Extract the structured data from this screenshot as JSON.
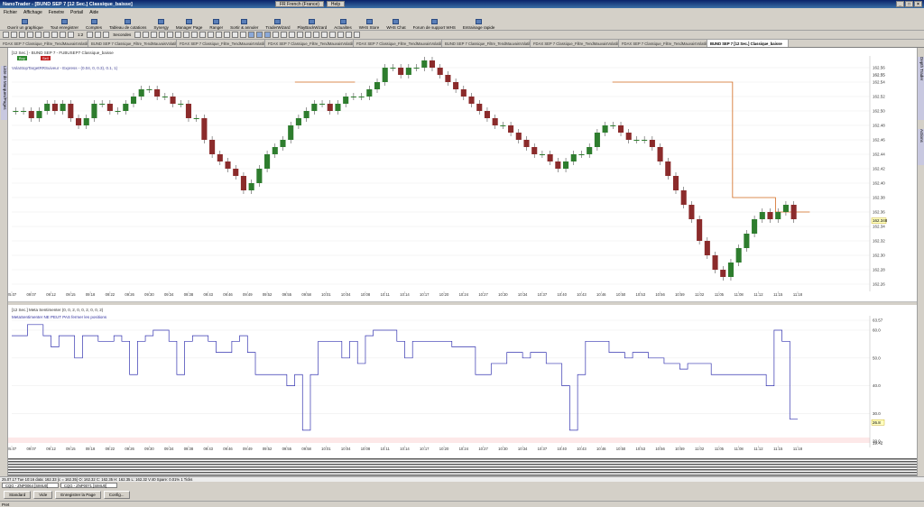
{
  "window": {
    "title": "NanoTrader - [BUND SEP 7 [12 Sec.] Classique_baisse]",
    "center_items": [
      "FR French (France)",
      "Help"
    ]
  },
  "menu": [
    "Fichier",
    "Affichage",
    "Fenetre",
    "Portail",
    "Aide"
  ],
  "toolbar": [
    {
      "label": "Ouvrir un graphique",
      "icon": "chart-open-icon"
    },
    {
      "label": "Tout enregistrer",
      "icon": "save-all-icon"
    },
    {
      "label": "Comptes",
      "icon": "accounts-icon"
    },
    {
      "label": "Tableau de cotations",
      "icon": "quotes-table-icon"
    },
    {
      "label": "Synergy",
      "icon": "synergy-icon"
    },
    {
      "label": "Manager Page",
      "icon": "page-manager-icon"
    },
    {
      "label": "Ranger",
      "icon": "ranger-icon"
    },
    {
      "label": "Sortir & annuler",
      "icon": "exit-cancel-icon"
    },
    {
      "label": "TraderWizard",
      "icon": "wizard-icon"
    },
    {
      "label": "PlayBackWizard",
      "icon": "playback-icon"
    },
    {
      "label": "Actualites",
      "icon": "news-icon"
    },
    {
      "label": "WHS Store",
      "icon": "store-icon"
    },
    {
      "label": "WHS Chat",
      "icon": "chat-icon"
    },
    {
      "label": "Forum de support WHS",
      "icon": "forum-icon"
    },
    {
      "label": "Entrainage rapide",
      "icon": "runner-icon"
    }
  ],
  "toolbar2": {
    "zoom": "1:2",
    "period": "Secondes"
  },
  "tabs": [
    "FDAX SEP 7 Classique_Filtre_TendMauvaisVolatilite_TargetRRSuiveur_baisse - ZNP0071 [SIMU0]",
    "BUND SEP 7 Classique_Filtre_TendMauvaisVolatilite_TargetRRSuiveur_baisse - ZNP0071 [SIMU0]",
    "FDAX SEP 7 Classique_Filtre_TendMauvaisVolatilite_TargetRRSuiveur_baisse - ZNP0071 [SIMU0]",
    "FDAX SEP 7 Classique_Filtre_TendMauvaisVolatilite_TargetRRSuiveur_baisse - ZNP0071 [SIMU0]",
    "FDAX SEP 7 Classique_Filtre_TendMauvaisVolatilite_TargetRRSuiveur_baisse - ZNP0071 [SIMU0]",
    "BUND SEP 7 Classique_Filtre_TendMauvaisVolatilite_TargetRRSuiveur_baisse - ZNP0071 [SIMU0]",
    "FDAX SEP 7 Classique_Filtre_TendMauvaisVolatilite_TargetRRSuiveur_baisse - ZNP0071 [SIMU0]",
    "FDAX SEP 7 Classique_Filtre_TendMauvaisVolatilite_TargetRRSuiveur_baisse - ZNP0071 [SIMU0]",
    "BUND SEP 7 [12 Sec.] Classique_baisse"
  ],
  "left_strip_label": "Liste de Marques/Pages",
  "right_strip_labels": [
    "Depth Trader",
    "Actions"
  ],
  "price_pane": {
    "header": "[12 Sec.] - BUND SEP 7 - FUBUSEP7 Classique_baisse",
    "buy_label": "Buy",
    "sell_label": "Sell",
    "indicator_label": "VolaStopTargetRRSuiveur - Express - (0.04, 0, 0.3), 0.1, 1)",
    "y_ticks": [
      "162.56",
      "162.54",
      "162.52",
      "162.50",
      "162.48",
      "162.46",
      "162.44",
      "162.42",
      "162.40",
      "162.38",
      "162.36",
      "162.34",
      "162.32",
      "162.30",
      "162.28",
      "162.26"
    ],
    "last_price": "162.348",
    "last_price_top": "162.55"
  },
  "time_ticks": [
    "25.07",
    "09:07",
    "09:12",
    "09:15",
    "09:18",
    "09:22",
    "09:26",
    "09:30",
    "09:34",
    "09:38",
    "09:43",
    "09:46",
    "09:49",
    "09:52",
    "09:55",
    "09:58",
    "10:01",
    "10:04",
    "10:08",
    "10:11",
    "10:14",
    "10:17",
    "10:20",
    "10:24",
    "10:27",
    "10:30",
    "10:34",
    "10:37",
    "10:40",
    "10:43",
    "10:46",
    "10:50",
    "10:53",
    "10:56",
    "10:59",
    "11:02",
    "11:05",
    "11:08",
    "11:12",
    "11:15",
    "11:18"
  ],
  "sentiment_pane": {
    "header": "[12 Sec.] Meta Sentimenter (0, 0, 2, 0, 0, 2, 0, 0, 2)",
    "subtitle": "MetaSentimenter NE PEUT PAS fermer les positions",
    "y_ticks": [
      "63.57",
      "60.0",
      "50.0",
      "40.0",
      "30.0",
      "20.0"
    ],
    "current_value": "26.8",
    "bottom_value": "19.42"
  },
  "status_line": "25.07.17 Tue 10:16 data: 162.33 (c = 162.35)     O: 162.32 C: 162.35 H: 162.35 L: 162.32 V:40 Spare: 0.01% 1 Ticks",
  "accounts": [
    "CQG - ZNP0064 [SIMU0]",
    "CQG - ZNP0071 [SIMU0]"
  ],
  "bottom_buttons": [
    "Standard",
    "Vide",
    "Enregistrer la Page",
    "Config..."
  ],
  "status_bottom": "Pret",
  "chart_data": [
    {
      "type": "candlestick",
      "title": "[12 Sec.] - BUND SEP 7 - FUBUSEP7 Classique_baisse",
      "ylim": [
        162.25,
        162.57
      ],
      "series": [
        {
          "name": "BUND SEP 7",
          "close": [
            162.5,
            162.5,
            162.49,
            162.5,
            162.51,
            162.5,
            162.51,
            162.49,
            162.48,
            162.49,
            162.51,
            162.51,
            162.5,
            162.5,
            162.51,
            162.52,
            162.53,
            162.53,
            162.52,
            162.52,
            162.51,
            162.51,
            162.49,
            162.49,
            162.46,
            162.44,
            162.43,
            162.42,
            162.41,
            162.39,
            162.4,
            162.42,
            162.44,
            162.45,
            162.46,
            162.48,
            162.49,
            162.5,
            162.51,
            162.51,
            162.5,
            162.51,
            162.52,
            162.52,
            162.52,
            162.53,
            162.54,
            162.56,
            162.56,
            162.55,
            162.56,
            162.56,
            162.57,
            162.56,
            162.55,
            162.54,
            162.53,
            162.52,
            162.51,
            162.5,
            162.49,
            162.48,
            162.48,
            162.47,
            162.46,
            162.45,
            162.44,
            162.44,
            162.43,
            162.42,
            162.43,
            162.44,
            162.44,
            162.45,
            162.47,
            162.48,
            162.48,
            162.47,
            162.46,
            162.46,
            162.46,
            162.45,
            162.43,
            162.41,
            162.39,
            162.37,
            162.35,
            162.32,
            162.3,
            162.28,
            162.27,
            162.29,
            162.31,
            162.33,
            162.35,
            162.36,
            162.35,
            162.36,
            162.37,
            162.35
          ]
        }
      ],
      "overlay": {
        "name": "VolaStopTargetRRSuiveur",
        "levels": [
          162.54,
          162.54,
          162.38,
          162.36
        ]
      }
    },
    {
      "type": "line",
      "title": "[12 Sec.] Meta Sentimenter (0, 0, 2, 0, 0, 2, 0, 0, 2)",
      "ylim": [
        19.42,
        63.57
      ],
      "series": [
        {
          "name": "Meta Sentimenter",
          "values": [
            58,
            58,
            62,
            62,
            58,
            54,
            58,
            58,
            50,
            58,
            58,
            56,
            56,
            58,
            56,
            44,
            56,
            58,
            60,
            60,
            56,
            44,
            56,
            58,
            58,
            56,
            52,
            52,
            56,
            58,
            52,
            44,
            44,
            44,
            44,
            40,
            44,
            24,
            44,
            56,
            56,
            56,
            50,
            56,
            48,
            58,
            60,
            60,
            60,
            56,
            50,
            56,
            56,
            56,
            56,
            56,
            54,
            54,
            54,
            44,
            44,
            48,
            48,
            52,
            52,
            50,
            52,
            52,
            48,
            48,
            40,
            24,
            44,
            56,
            56,
            56,
            52,
            52,
            50,
            52,
            52,
            50,
            50,
            48,
            48,
            46,
            48,
            48,
            48,
            44,
            44,
            44,
            44,
            44,
            44,
            44,
            40,
            60,
            56,
            28
          ]
        }
      ]
    }
  ]
}
